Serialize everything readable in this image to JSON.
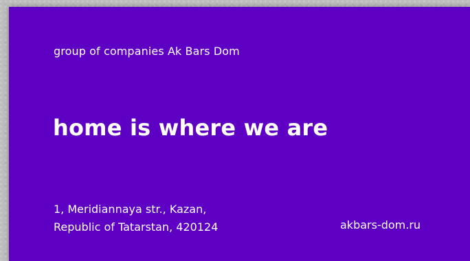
{
  "card": {
    "tagline": "group of companies Ak Bars Dom",
    "headline": "home is where we are",
    "address_line1": "1, Meridiannaya str., Kazan,",
    "address_line2": "Republic of Tatarstan, 420124",
    "website": "akbars-dom.ru",
    "background_color": "#5e00c3",
    "text_color": "#ffffff"
  }
}
